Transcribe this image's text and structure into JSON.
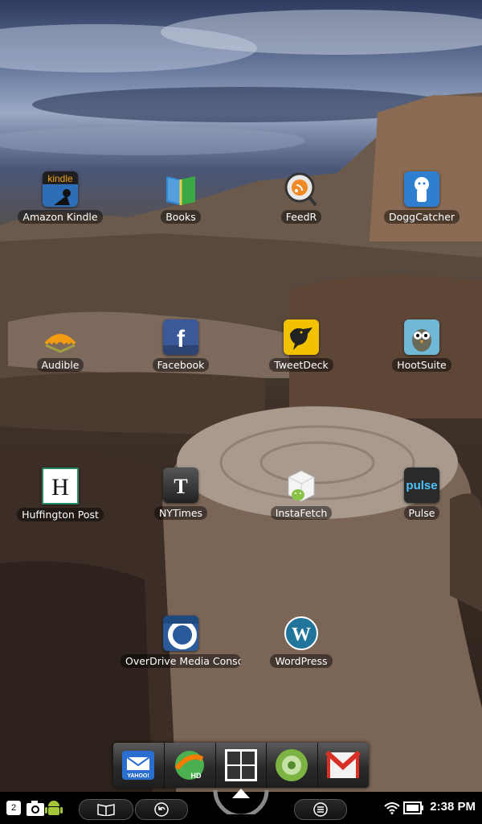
{
  "apps": [
    {
      "label": "Amazon Kindle",
      "icon": "amazon-kindle-icon"
    },
    {
      "label": "Books",
      "icon": "books-icon"
    },
    {
      "label": "FeedR",
      "icon": "feedr-icon"
    },
    {
      "label": "DoggCatcher",
      "icon": "doggcatcher-icon"
    },
    {
      "label": "Audible",
      "icon": "audible-icon"
    },
    {
      "label": "Facebook",
      "icon": "facebook-icon"
    },
    {
      "label": "TweetDeck",
      "icon": "tweetdeck-icon"
    },
    {
      "label": "HootSuite",
      "icon": "hootsuite-icon"
    },
    {
      "label": "Huffington Post",
      "icon": "huffington-post-icon"
    },
    {
      "label": "NYTimes",
      "icon": "nytimes-icon"
    },
    {
      "label": "InstaFetch",
      "icon": "instafetch-icon"
    },
    {
      "label": "Pulse",
      "icon": "pulse-icon"
    },
    {
      "label": "OverDrive Media Console",
      "icon": "overdrive-icon"
    },
    {
      "label": "WordPress",
      "icon": "wordpress-icon"
    }
  ],
  "icon_text": {
    "kindle": "kindle",
    "facebook": "f",
    "huffington": "H",
    "pulse": "pulse",
    "yahoo": "YAHOO!",
    "hd": "HD"
  },
  "dock": [
    {
      "icon": "yahoo-mail-icon"
    },
    {
      "icon": "browser-hd-icon"
    },
    {
      "icon": "app-drawer-icon"
    },
    {
      "icon": "media-icon"
    },
    {
      "icon": "gmail-icon"
    }
  ],
  "status": {
    "notification_count": "2",
    "time": "2:38 PM"
  },
  "colors": {
    "facebook": "#3b5998",
    "kindle": "#1f1f1f",
    "tweetdeck": "#f2c200",
    "gmail": "#d93025"
  }
}
